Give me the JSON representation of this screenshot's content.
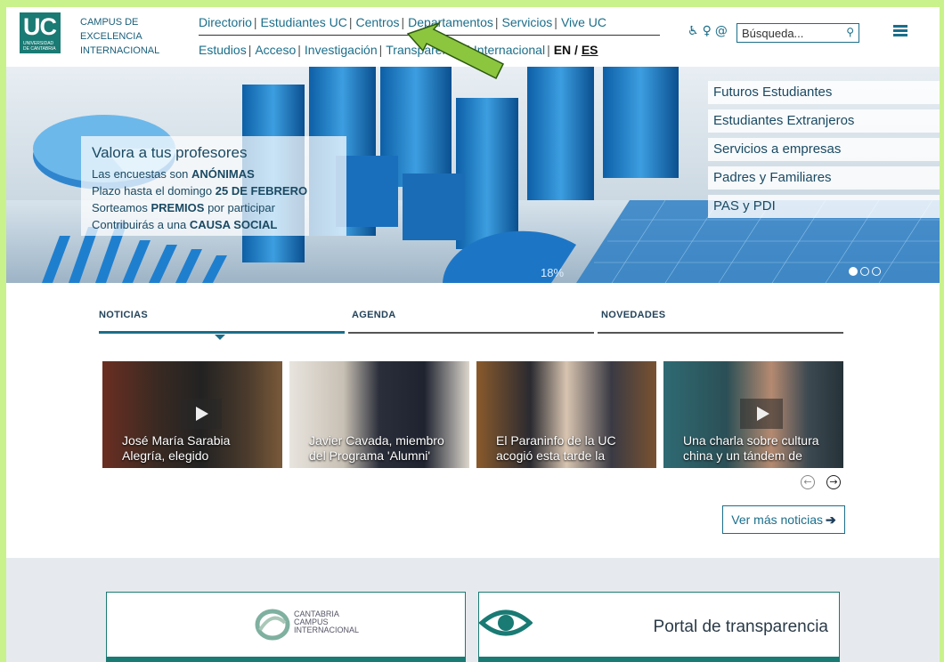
{
  "header": {
    "logo_text": "UC",
    "logo_subtext": "UNIVERSIDAD DE CANTABRIA",
    "campus_lines": [
      "CAMPUS DE",
      "EXCELENCIA",
      "INTERNACIONAL"
    ],
    "nav_primary": [
      "Directorio",
      "Estudiantes UC",
      "Centros",
      "Departamentos",
      "Servicios",
      "Vive UC"
    ],
    "nav_secondary": [
      "Estudios",
      "Acceso",
      "Investigación",
      "Transparencia",
      "Internacional"
    ],
    "lang_en": "EN",
    "lang_sep": "/",
    "lang_es": "ES",
    "search_placeholder": "Búsqueda...",
    "icons": [
      "accessibility-icon",
      "lightbulb-icon",
      "at-sign-icon",
      "search-icon",
      "menu-icon"
    ]
  },
  "hero": {
    "title": "Valora a tus profesores",
    "lines": [
      {
        "pre": "Las encuestas son ",
        "bold": "ANÓNIMAS",
        "post": ""
      },
      {
        "pre": "Plazo hasta el domingo ",
        "bold": "25 DE FEBRERO",
        "post": ""
      },
      {
        "pre": "Sorteamos ",
        "bold": "PREMIOS",
        "post": " por participar"
      },
      {
        "pre": "Contribuirás a una ",
        "bold": "CAUSA SOCIAL",
        "post": ""
      }
    ],
    "quick_links": [
      "Futuros Estudiantes",
      "Estudiantes Extranjeros",
      "Servicios a empresas",
      "Padres y Familiares",
      "PAS y PDI"
    ],
    "slide_dots": 3,
    "active_slide": 1,
    "chart_label_percent": "18%"
  },
  "tabs": [
    {
      "label": "NOTICIAS",
      "active": true
    },
    {
      "label": "AGENDA",
      "active": false
    },
    {
      "label": "NOVEDADES",
      "active": false
    }
  ],
  "news": [
    {
      "caption": "José María Sarabia Alegría, elegido",
      "bg": "#3a2a22"
    },
    {
      "caption": "Javier Cavada, miembro del Programa 'Alumni'",
      "bg": "#5c5550"
    },
    {
      "caption": "El Paraninfo de la UC acogió esta tarde la",
      "bg": "#6a4a2a"
    },
    {
      "caption": "Una charla sobre cultura china y un tándem de",
      "bg": "#2f4f55"
    }
  ],
  "more_news_label": "Ver más noticias",
  "more_news_arrow": "➔",
  "bottom": {
    "cci_lines": [
      "CANTABRIA",
      "CAMPUS",
      "INTERNACIONAL"
    ],
    "transparency_label": "Portal de transparencia"
  },
  "colors": {
    "brand_teal": "#1a7a74",
    "link_blue": "#1b6e8a",
    "annotation_green": "#8cc63f"
  }
}
